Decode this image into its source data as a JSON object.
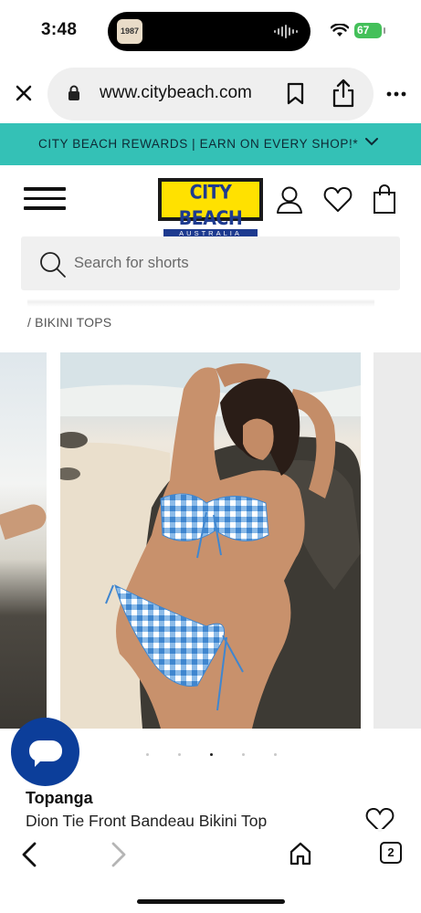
{
  "status_bar": {
    "time": "3:48",
    "battery": "67",
    "island_thumb_text": "1987"
  },
  "browser": {
    "url": "www.citybeach.com",
    "icons": [
      "close-icon",
      "lock-icon",
      "bookmark-icon",
      "share-icon",
      "more-icon"
    ]
  },
  "banner": {
    "text": "CITY BEACH REWARDS | EARN ON EVERY SHOP!*",
    "color": "#34c1b6"
  },
  "header": {
    "logo_main": "CITY BEACH",
    "logo_sub": "AUSTRALIA",
    "logo_colors": {
      "background": "#ffe100",
      "text": "#1d3a8f"
    },
    "icons": [
      "menu-icon",
      "account-icon",
      "wishlist-icon",
      "bag-icon"
    ]
  },
  "search": {
    "placeholder": "Search for shorts"
  },
  "breadcrumb": {
    "current": "/ BIKINI TOPS"
  },
  "carousel": {
    "slide_count": 5,
    "active_index": 2
  },
  "product": {
    "brand": "Topanga",
    "name": "Dion Tie Front Bandeau Bikini Top"
  },
  "toolbar": {
    "tab_count": "2",
    "icons": [
      "back-icon",
      "forward-icon",
      "home-icon",
      "tabs-icon"
    ]
  },
  "colors": {
    "chat_button": "#0c3e9a",
    "gingham_blue": "#4f95d6"
  }
}
